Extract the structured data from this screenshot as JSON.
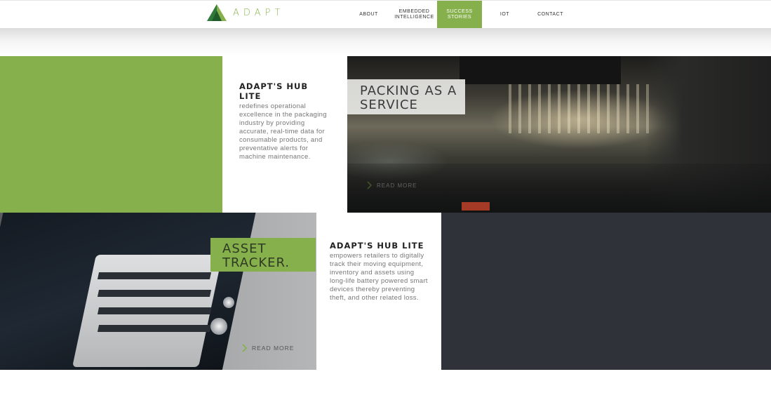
{
  "brand": {
    "name": "ADAPT",
    "accent": "#86b04c",
    "dark": "#2f3339"
  },
  "nav": {
    "items": [
      {
        "label": "ABOUT"
      },
      {
        "label": "EMBEDDED INTELLIGENCE"
      },
      {
        "label": "SUCCESS STORIES",
        "active": true
      },
      {
        "label": "IOT"
      },
      {
        "label": "CONTACT"
      }
    ]
  },
  "packing": {
    "card_title": "ADAPT'S HUB LITE",
    "card_body": "redefines operational excellence in the packaging industry by providing accurate, real-time data for consumable products, and preventative alerts for machine maintenance.",
    "overlay_title": "PACKING AS A SERVICE",
    "read_more": "READ MORE"
  },
  "asset": {
    "card_title": "ADAPT'S HUB LITE",
    "card_body": "empowers retailers to digitally track their moving equipment, inventory and assets using long-life battery powered smart devices thereby preventing theft, and other related loss.",
    "overlay_title": "ASSET TRACKER.",
    "read_more": "READ MORE"
  },
  "icons": {
    "logo": "adapt-triangle-logo",
    "read_more": "chevron-right-icon"
  }
}
